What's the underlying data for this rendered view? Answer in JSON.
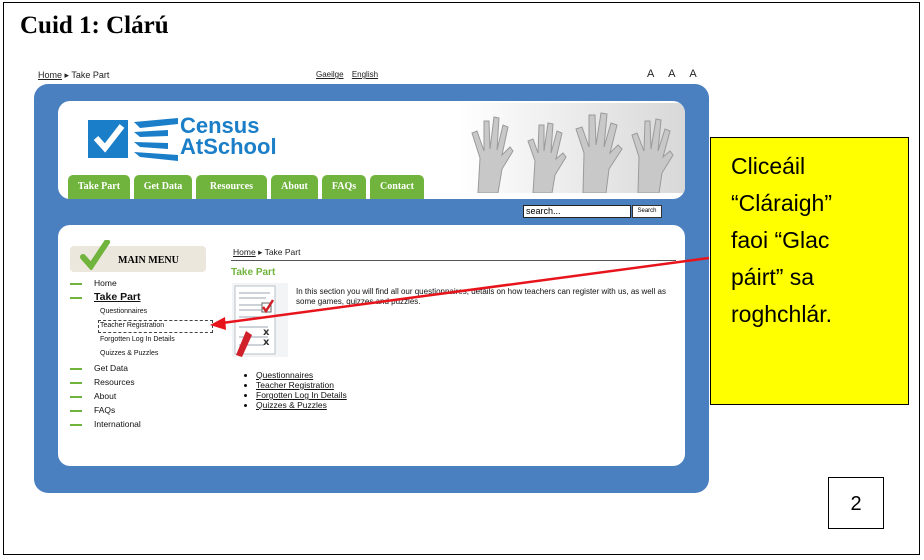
{
  "heading": "Cuid 1:  Clárú",
  "screenshot": {
    "topbar": {
      "crumb_home": "Home",
      "crumb_sep": "▸",
      "crumb_current": "Take Part",
      "lang_ga": "Gaeilge",
      "lang_en": "English",
      "tools": "A A A"
    },
    "logo": {
      "line1": "Census",
      "line2": "AtSchool"
    },
    "nav": [
      "Take Part",
      "Get Data",
      "Resources",
      "About",
      "FAQs",
      "Contact"
    ],
    "search": {
      "value": "search...",
      "button": "Search"
    },
    "menu_title": "MAIN MENU",
    "menu": {
      "home": "Home",
      "take_part": "Take Part",
      "sub": [
        "Questionnaires",
        "Teacher Registration",
        "Forgotten Log In Details",
        "Quizzes & Puzzles"
      ],
      "rest": [
        "Get Data",
        "Resources",
        "About",
        "FAQs",
        "International"
      ]
    },
    "main": {
      "crumb_home": "Home",
      "crumb_sep": "▸",
      "crumb_current": "Take Part",
      "title": "Take Part",
      "intro": "In this section you will find all our questionnaires, details on how teachers can register with us, as well as some games, quizzes and puzzles.",
      "links": [
        "Questionnaires",
        "Teacher Registration",
        "Forgotten Log In Details",
        "Quizzes & Puzzles"
      ]
    }
  },
  "callout": [
    "Cliceáil",
    "“Cláraigh”",
    "faoi “Glac",
    "páirt” sa",
    "roghchlár."
  ],
  "page_number": "2",
  "colors": {
    "site_blue": "#4b80c0",
    "nav_green": "#70b43d",
    "callout_yellow": "#ffff00",
    "arrow_red": "#e8141c"
  }
}
